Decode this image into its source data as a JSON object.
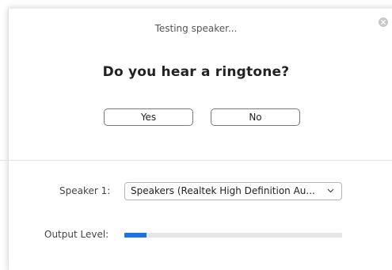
{
  "dialog": {
    "status_text": "Testing speaker...",
    "question": "Do you hear a ringtone?",
    "yes_label": "Yes",
    "no_label": "No"
  },
  "speaker": {
    "label": "Speaker 1:",
    "selected": "Speakers (Realtek High Definition Au..."
  },
  "output": {
    "label": "Output Level:",
    "level_fraction": 0.1
  },
  "colors": {
    "level_fill": "#1a73e8",
    "close_button": "#c9c9c9"
  },
  "icons": {
    "close": "close-icon",
    "dropdown": "chevron-down-icon"
  }
}
